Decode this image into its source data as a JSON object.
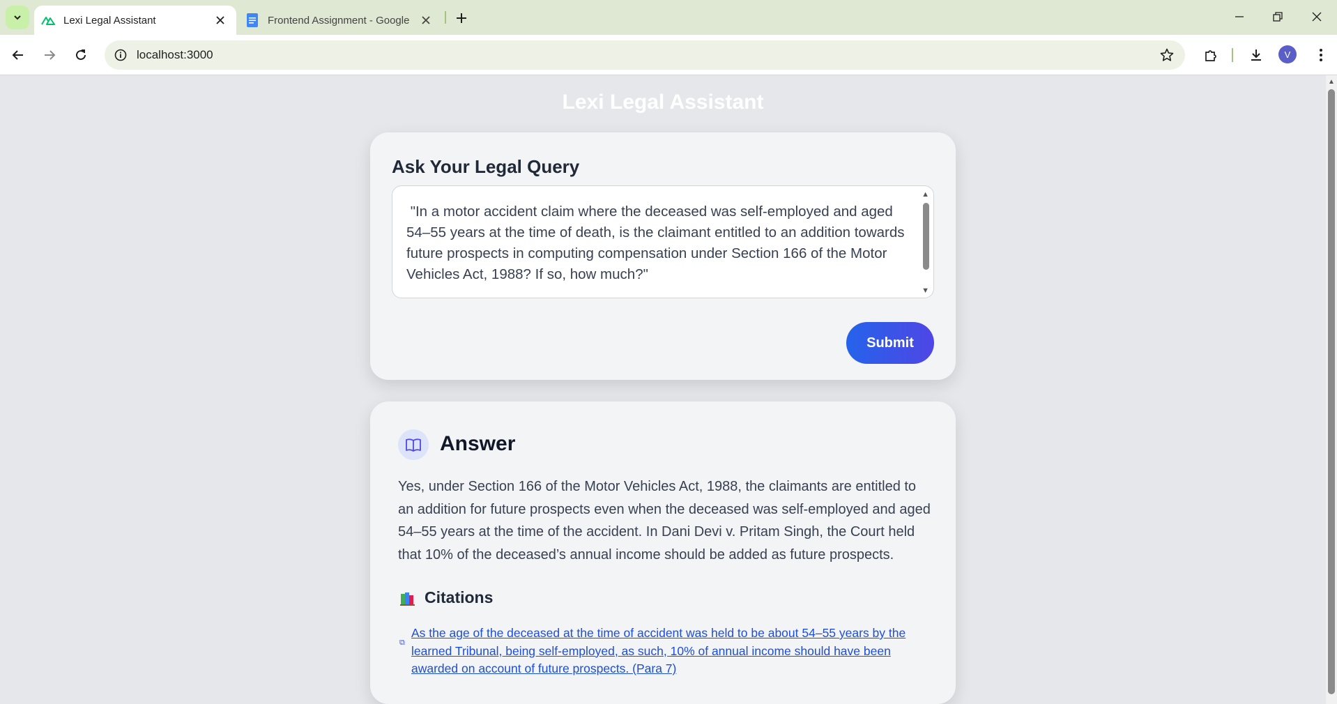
{
  "browser": {
    "tabs": [
      {
        "title": "Lexi Legal Assistant",
        "active": true,
        "icon": "nuxt-logo-icon"
      },
      {
        "title": "Frontend Assignment - Google",
        "active": false,
        "icon": "google-docs-icon"
      }
    ],
    "address": "localhost:3000",
    "profile_initial": "V"
  },
  "app": {
    "title": "Lexi Legal Assistant"
  },
  "query_card": {
    "heading": "Ask Your Legal Query",
    "query_text": " \"In a motor accident claim where the deceased was self-employed and aged 54–55 years at the time of death, is the claimant entitled to an addition towards future prospects in computing compensation under Section 166 of the Motor Vehicles Act, 1988? If so, how much?\"",
    "submit_label": "Submit"
  },
  "answer_card": {
    "heading": "Answer",
    "text": "Yes, under Section 166 of the Motor Vehicles Act, 1988, the claimants are entitled to an addition for future prospects even when the deceased was self-employed and aged 54–55 years at the time of the accident. In Dani Devi v. Pritam Singh, the Court held that 10% of the deceased’s annual income should be added as future prospects.",
    "citations_heading": "Citations",
    "citations": [
      {
        "text": "As the age of the deceased at the time of accident was held to be about 54–55 years by the learned Tribunal, being self-employed, as such, 10% of annual income should have been awarded on account of future prospects. (Para 7)"
      }
    ]
  },
  "colors": {
    "accent_start": "#2563eb",
    "accent_end": "#4f46e5",
    "link": "#1d4ed8"
  }
}
